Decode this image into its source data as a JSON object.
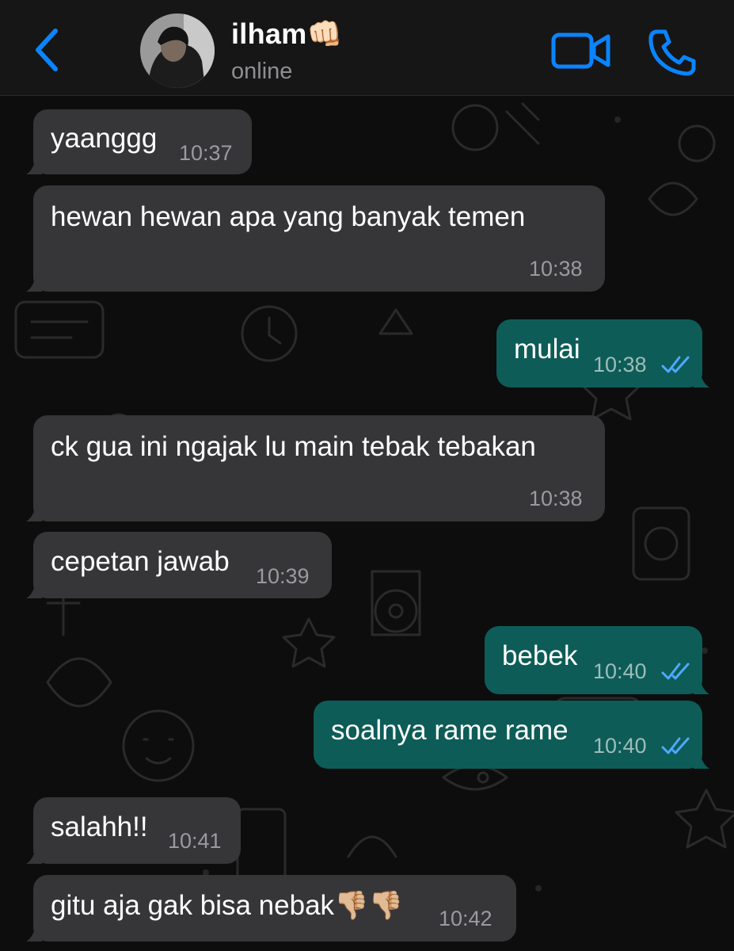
{
  "header": {
    "back_icon": "chevron-left-icon",
    "contact_name": "ilham👊🏻",
    "status": "online",
    "video_icon": "video-camera-icon",
    "call_icon": "phone-icon",
    "accent_color": "#0a84ff"
  },
  "messages": [
    {
      "direction": "incoming",
      "text": "yaanggg",
      "time": "10:37"
    },
    {
      "direction": "incoming",
      "text": "hewan hewan apa yang banyak temen",
      "time": "10:38"
    },
    {
      "direction": "outgoing",
      "text": "mulai",
      "time": "10:38",
      "status": "read"
    },
    {
      "direction": "incoming",
      "text": "ck gua ini ngajak lu main tebak tebakan",
      "time": "10:38"
    },
    {
      "direction": "incoming",
      "text": "cepetan jawab",
      "time": "10:39"
    },
    {
      "direction": "outgoing",
      "text": "bebek",
      "time": "10:40",
      "status": "read"
    },
    {
      "direction": "outgoing",
      "text": "soalnya rame rame",
      "time": "10:40",
      "status": "read"
    },
    {
      "direction": "incoming",
      "text": "salahh!!",
      "time": "10:41"
    },
    {
      "direction": "incoming",
      "text": "gitu aja gak bisa nebak👎🏼👎🏼",
      "time": "10:42"
    }
  ],
  "colors": {
    "incoming_bubble": "#363638",
    "outgoing_bubble": "#0d5c57",
    "read_ticks": "#4fa8ff"
  }
}
